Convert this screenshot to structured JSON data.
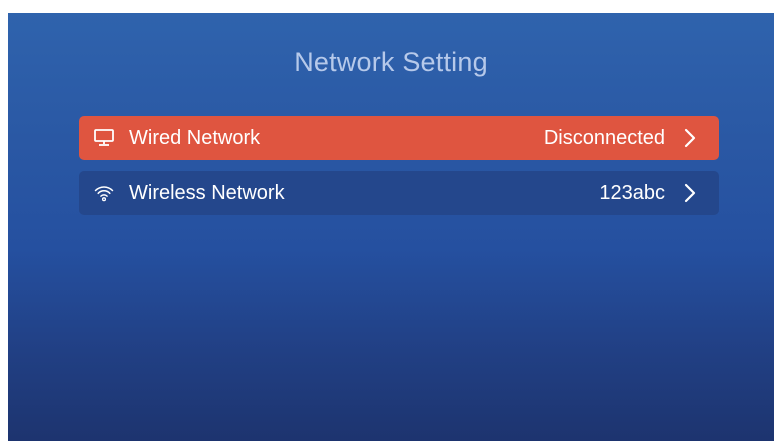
{
  "screen": {
    "title": "Network Setting"
  },
  "items": [
    {
      "label": "Wired Network",
      "value": "Disconnected",
      "icon": "monitor-icon",
      "selected": true
    },
    {
      "label": "Wireless Network",
      "value": "123abc",
      "icon": "wifi-icon",
      "selected": false
    }
  ],
  "colors": {
    "selected_row": "#df5540",
    "row": "#24478c",
    "background_top": "#2f63ad",
    "background_bottom": "#1d346f",
    "title": "#b6c9ea",
    "text": "#ffffff"
  }
}
